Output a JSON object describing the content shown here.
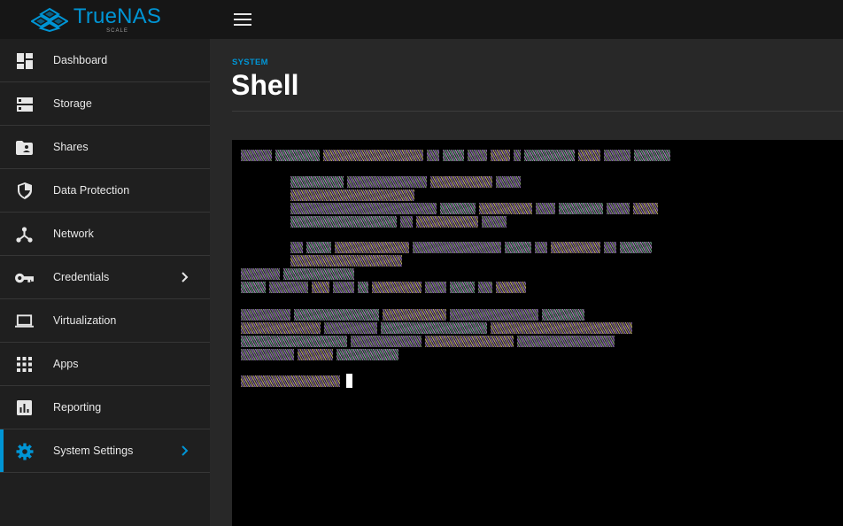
{
  "app": {
    "name": "TrueNAS",
    "edition": "SCALE"
  },
  "colors": {
    "accent": "#0095d5",
    "sidebar_bg": "#1f1f1f",
    "topbar_bg": "#161616",
    "terminal_bg": "#000000"
  },
  "sidebar": {
    "items": [
      {
        "label": "Dashboard",
        "icon": "dashboard-icon"
      },
      {
        "label": "Storage",
        "icon": "storage-icon"
      },
      {
        "label": "Shares",
        "icon": "shares-folder-icon"
      },
      {
        "label": "Data Protection",
        "icon": "shield-icon"
      },
      {
        "label": "Network",
        "icon": "network-icon"
      },
      {
        "label": "Credentials",
        "icon": "key-icon",
        "has_submenu": true
      },
      {
        "label": "Virtualization",
        "icon": "laptop-icon"
      },
      {
        "label": "Apps",
        "icon": "apps-grid-icon"
      },
      {
        "label": "Reporting",
        "icon": "bar-chart-icon"
      },
      {
        "label": "System Settings",
        "icon": "gear-icon",
        "has_submenu": true,
        "active": true
      }
    ]
  },
  "page": {
    "breadcrumb": "SYSTEM",
    "title": "Shell"
  }
}
